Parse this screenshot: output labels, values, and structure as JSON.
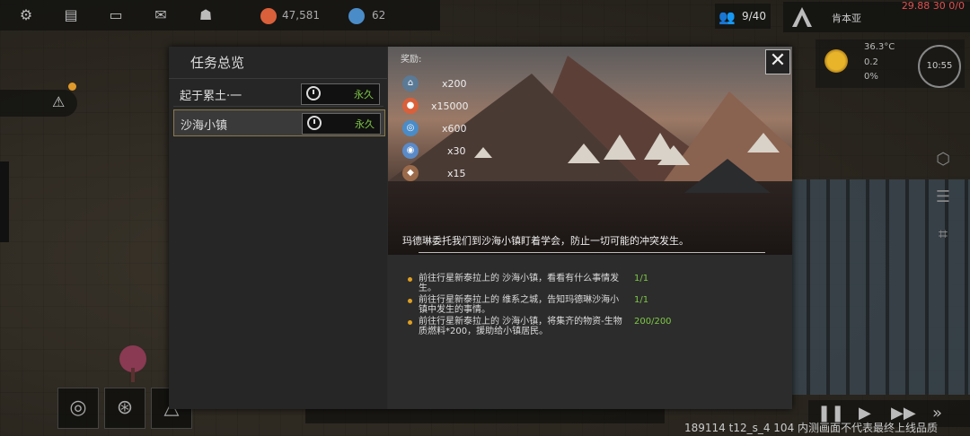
{
  "hud": {
    "resource1_value": "47,581",
    "resource2_value": "62",
    "population": "9/40",
    "player_name": "肯本亚",
    "fps_readout": "29.88 30 0/0",
    "temperature": "36.3°C",
    "wind": "0.2",
    "humidity": "0%",
    "time": "10:55"
  },
  "quest_panel": {
    "title": "任务总览",
    "quests": [
      {
        "name": "起于累土·一",
        "status": "永久",
        "selected": false
      },
      {
        "name": "沙海小镇",
        "status": "永久",
        "selected": true
      }
    ]
  },
  "quest_detail": {
    "rewards_label": "奖励:",
    "rewards": [
      {
        "icon": "building-token-icon",
        "qty": "x200"
      },
      {
        "icon": "orange-coin-icon",
        "qty": "x15000"
      },
      {
        "icon": "blue-crystal-icon",
        "qty": "x600"
      },
      {
        "icon": "blue-gem-icon",
        "qty": "x30"
      },
      {
        "icon": "ore-icon",
        "qty": "x15"
      }
    ],
    "description": "玛德琳委托我们到沙海小镇盯着学会，防止一切可能的冲突发生。",
    "objectives": [
      {
        "text": "前往行星新泰拉上的 沙海小镇，看看有什么事情发生。",
        "progress": "1/1"
      },
      {
        "text": "前往行星新泰拉上的 维系之城，告知玛德琳沙海小镇中发生的事情。",
        "progress": "1/1"
      },
      {
        "text": "前往行星新泰拉上的 沙海小镇，将集齐的物资-生物质燃料*200，援助给小镇居民。",
        "progress": "200/200"
      }
    ]
  },
  "footer": {
    "watermark": "189114 t12_s_4 104  内测画面不代表最终上线品质"
  },
  "colors": {
    "accent_gold": "#8b7a4a",
    "progress_green": "#7ec846",
    "bullet_orange": "#e0a020",
    "fps_red": "#e05050"
  }
}
